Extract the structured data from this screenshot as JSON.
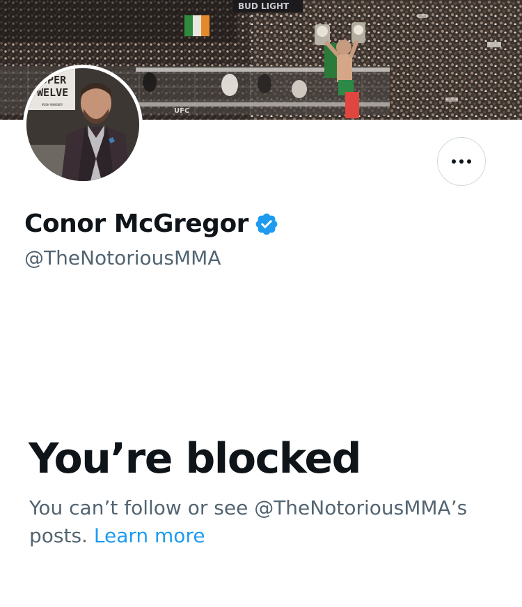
{
  "profile": {
    "display_name": "Conor McGregor",
    "handle": "@TheNotoriousMMA",
    "verified": true,
    "verified_color": "#1d9bf0",
    "avatar_icon": "profile-photo-avatar",
    "avatar_logo_text": [
      "ROPER",
      "TWELVE",
      "IRISH WHISKEY"
    ],
    "banner_icon": "arena-celebration-banner",
    "banner_sign_text": "BUD LIGHT",
    "banner_ring_text": "UFC"
  },
  "actions": {
    "more_icon": "more-options-icon"
  },
  "blocked": {
    "title": "You’re blocked",
    "description": "You can’t follow or see @TheNotoriousMMA’s posts.",
    "learn_more": "Learn more",
    "link_color": "#1d9bf0"
  }
}
